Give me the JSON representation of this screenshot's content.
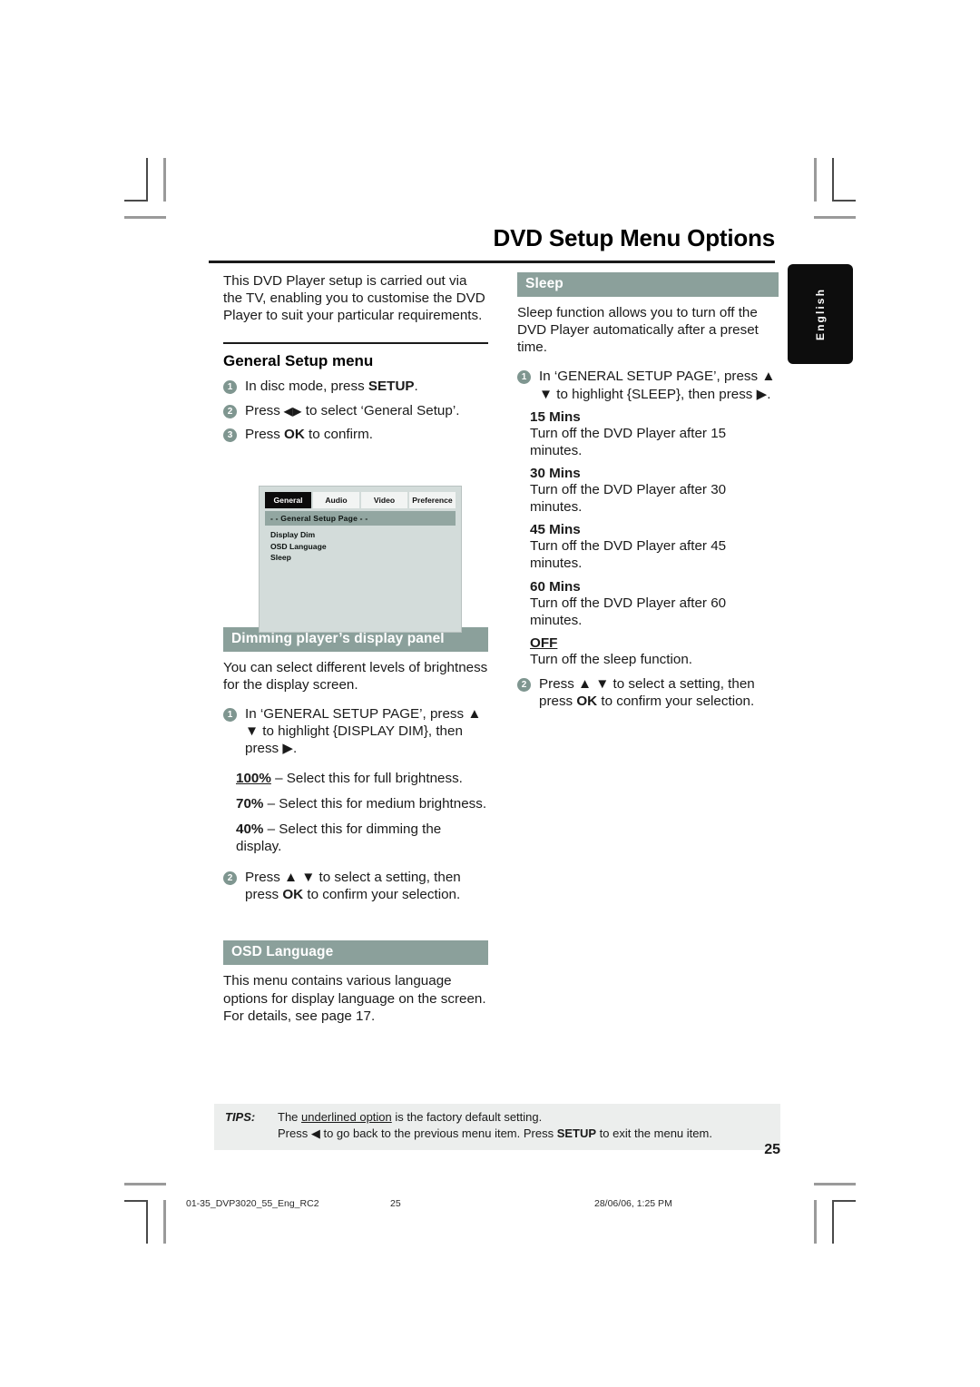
{
  "page_title": "DVD Setup Menu Options",
  "language_tab": "English",
  "left_column": {
    "intro": "This DVD Player setup is carried out via the TV, enabling you to customise the DVD Player to suit your particular requirements.",
    "general_setup_heading": "General Setup menu",
    "general_setup_steps": [
      {
        "num": "1",
        "text_before": "In disc mode, press ",
        "bold": "SETUP",
        "text_after": "."
      },
      {
        "num": "2",
        "text_before": "Press ",
        "bold": "◀▶",
        "text_after": " to select ‘General Setup’."
      },
      {
        "num": "3",
        "text_before": "Press ",
        "bold": "OK",
        "text_after": " to confirm."
      }
    ],
    "osd_screenshot": {
      "tabs": [
        "General",
        "Audio",
        "Video",
        "Preference"
      ],
      "active_tab": "General",
      "page_bar": "- -  General Setup Page   - -",
      "items": [
        "Display Dim",
        "OSD Language",
        "Sleep"
      ]
    },
    "dimming": {
      "bar_title": "Dimming player’s display panel",
      "intro": "You can select different levels of brightness for the display screen.",
      "step1": {
        "num": "1",
        "text": "In ‘GENERAL SETUP PAGE’, press ▲ ▼ to highlight {DISPLAY DIM}, then press ▶."
      },
      "options": [
        {
          "label": "100%",
          "underlined": true,
          "desc": " – Select this for full brightness."
        },
        {
          "label": "70%",
          "underlined": false,
          "desc": " – Select this for medium brightness."
        },
        {
          "label": "40%",
          "underlined": false,
          "desc": " – Select this for dimming the display."
        }
      ],
      "step2": {
        "num": "2",
        "text_before": "Press ▲ ▼  to select a setting, then press ",
        "bold": "OK",
        "text_after": " to confirm your selection."
      }
    },
    "osd_language": {
      "bar_title": "OSD Language",
      "body": "This menu contains various language options for display language on the screen. For details, see page 17."
    }
  },
  "right_column": {
    "sleep": {
      "bar_title": "Sleep",
      "intro": "Sleep function allows you to turn off the DVD Player automatically after a preset time.",
      "step1": {
        "num": "1",
        "text": "In ‘GENERAL SETUP PAGE’, press ▲ ▼ to highlight {SLEEP}, then press ▶."
      },
      "options": [
        {
          "term": "15 Mins",
          "underlined": false,
          "desc": "Turn off the DVD Player after 15 minutes."
        },
        {
          "term": "30 Mins",
          "underlined": false,
          "desc": "Turn off the DVD Player after 30 minutes."
        },
        {
          "term": "45 Mins",
          "underlined": false,
          "desc": "Turn off the DVD Player after 45 minutes."
        },
        {
          "term": "60 Mins",
          "underlined": false,
          "desc": "Turn off the DVD Player after 60 minutes."
        },
        {
          "term": "OFF",
          "underlined": true,
          "desc": "Turn off the sleep function."
        }
      ],
      "step2": {
        "num": "2",
        "text_before": "Press ▲ ▼ to select a setting, then press ",
        "bold": "OK",
        "text_after": " to confirm your selection."
      }
    }
  },
  "tips": {
    "label": "TIPS:",
    "line1_before": "The ",
    "line1_underlined": "underlined option",
    "line1_after": " is the factory default setting.",
    "line2_before": "Press ◀ to go back to the previous menu item. Press ",
    "line2_bold": "SETUP",
    "line2_after": " to exit the menu item."
  },
  "folio": "25",
  "print_slug": {
    "file": "01-35_DVP3020_55_Eng_RC2",
    "page": "25",
    "date": "28/06/06, 1:25 PM"
  },
  "colors": {
    "section_bar": "#8ba09b",
    "bullet": "#7f9690",
    "osd_background": "#d3dcda",
    "osd_page_bar": "#92a6a1",
    "tips_background": "#eceeed",
    "language_tab": "#0d0d0d"
  }
}
